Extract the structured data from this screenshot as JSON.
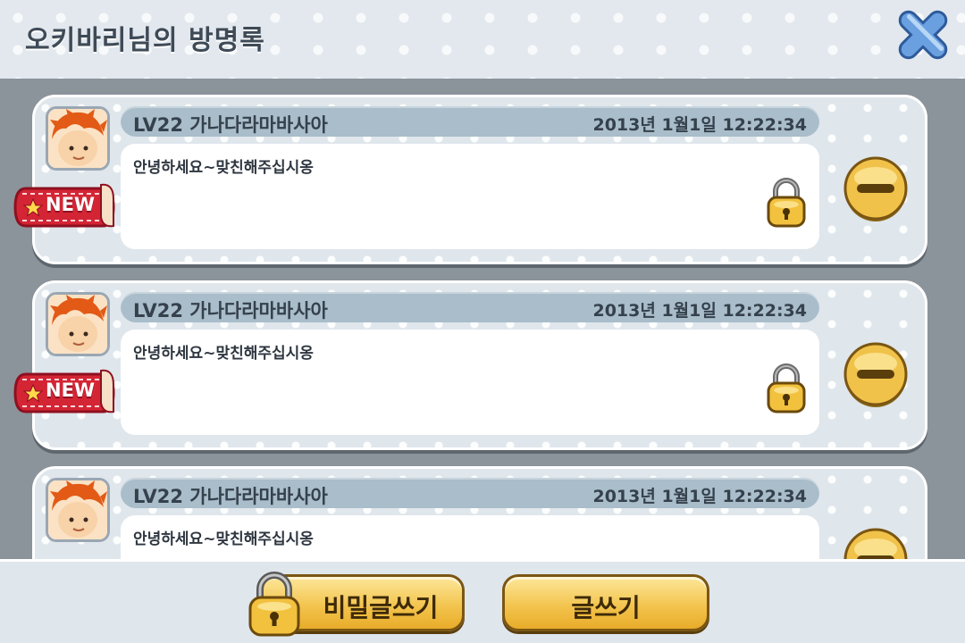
{
  "header": {
    "title": "오키바리님의 방명록",
    "close_icon": "close-x-icon"
  },
  "entries": [
    {
      "name": "LV22 가나다라마바사아",
      "date": "2013년 1월1일 12:22:34",
      "message": "안녕하세요~맞친해주십시옹",
      "badge": "NEW",
      "locked": true
    },
    {
      "name": "LV22 가나다라마바사아",
      "date": "2013년 1월1일 12:22:34",
      "message": "안녕하세요~맞친해주십시옹",
      "badge": "NEW",
      "locked": true
    },
    {
      "name": "LV22 가나다라마바사아",
      "date": "2013년 1월1일 12:22:34",
      "message": "안녕하세요~맞친해주십시옹",
      "badge": "",
      "locked": false
    }
  ],
  "footer": {
    "secret_write_label": "비밀글쓰기",
    "write_label": "글쓰기"
  },
  "colors": {
    "background": "#8b939b",
    "panel": "#dfe6ec",
    "name_bar": "#a9bdca",
    "button_gold": "#f2c24a",
    "badge_red": "#d42535",
    "close_blue": "#5a8ed0"
  }
}
